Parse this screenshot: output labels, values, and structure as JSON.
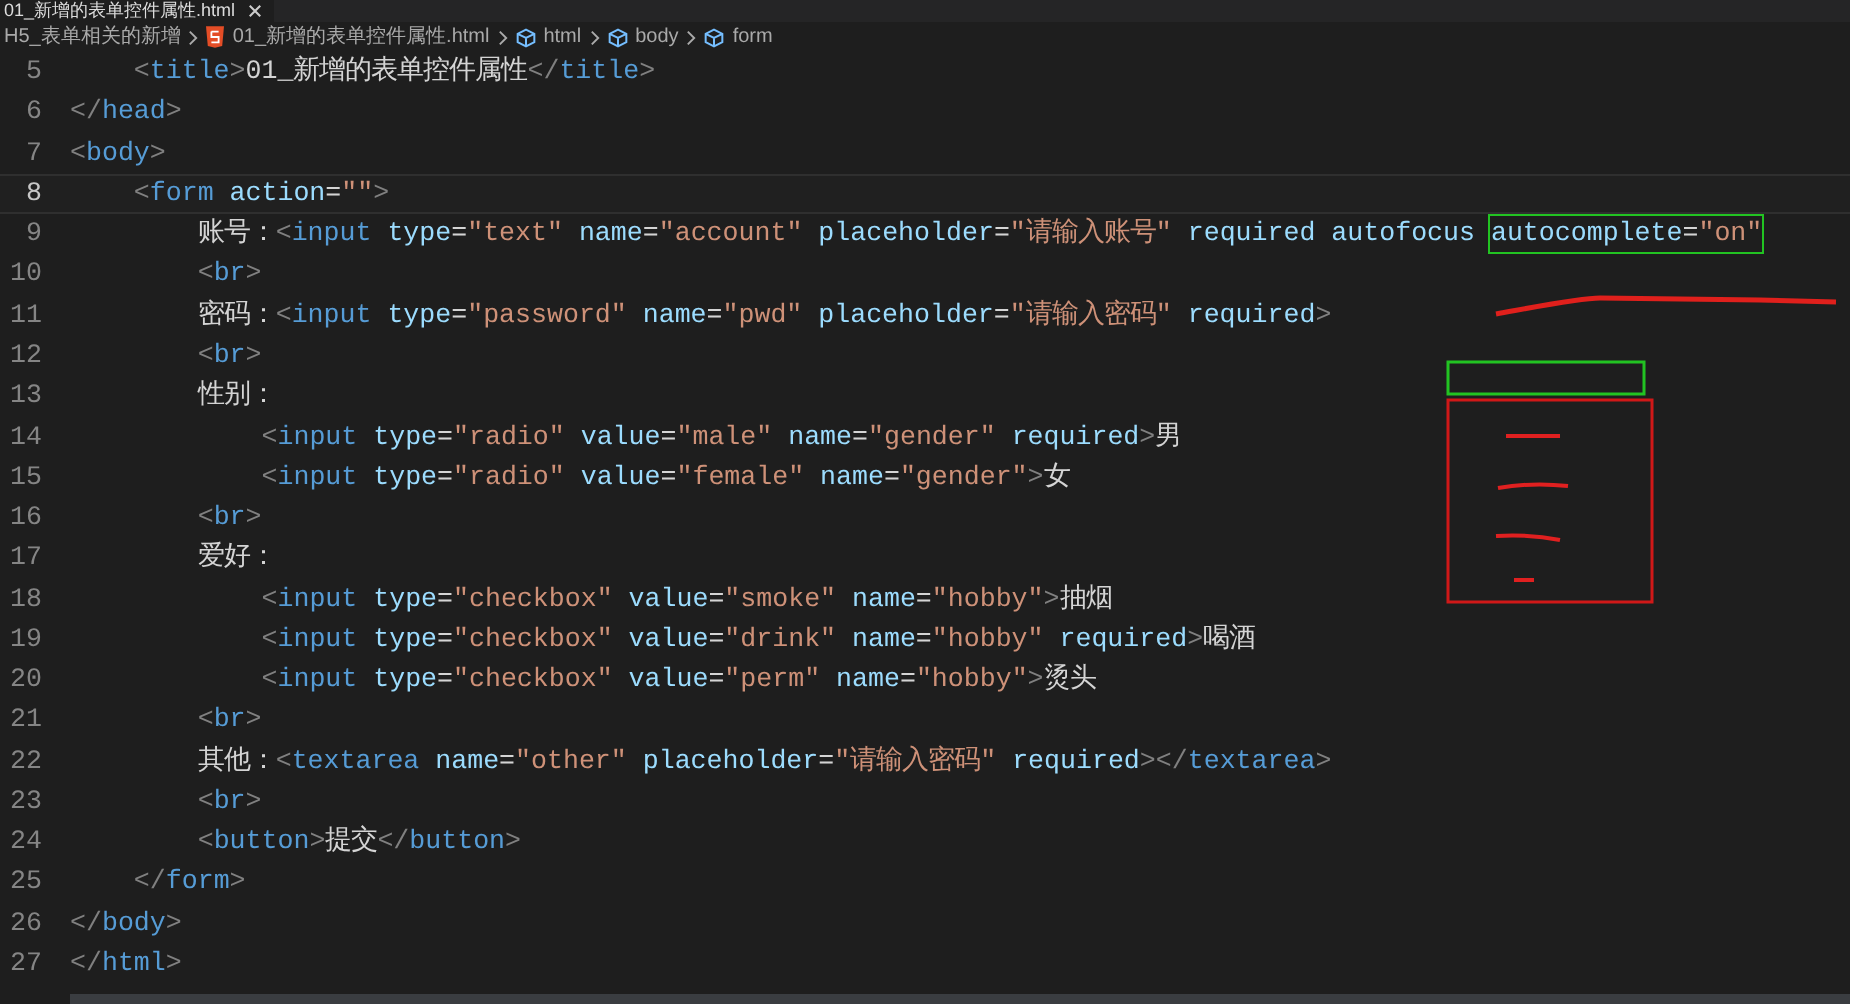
{
  "tab": {
    "title": "01_新增的表单控件属性.html"
  },
  "breadcrumb": [
    {
      "label": "H5_表单相关的新增",
      "kind": "folder"
    },
    {
      "label": "01_新增的表单控件属性.html",
      "kind": "file"
    },
    {
      "label": "html",
      "kind": "symbol"
    },
    {
      "label": "body",
      "kind": "symbol"
    },
    {
      "label": "form",
      "kind": "symbol"
    }
  ],
  "lines": [
    {
      "children": [
        {
          "num": "5",
          "current": false,
          "tokens": [
            {
              "kind": "p",
              "text": "<"
            },
            {
              "kind": "tag",
              "text": "title"
            },
            {
              "kind": "p",
              "text": ">"
            },
            {
              "kind": "text",
              "text": "01_新增的表单控件属性"
            },
            {
              "kind": "p",
              "text": "</"
            },
            {
              "kind": "tag",
              "text": "title"
            },
            {
              "kind": "p",
              "text": ">"
            }
          ]
        }
      ]
    },
    {
      "num": "6",
      "current": false,
      "tokens": [
        {
          "kind": "p",
          "text": "</"
        },
        {
          "kind": "tag",
          "text": "head"
        },
        {
          "kind": "p",
          "text": ">"
        }
      ]
    },
    {
      "num": "7",
      "current": false,
      "tokens": [
        {
          "kind": "p",
          "text": "<"
        },
        {
          "kind": "tag",
          "text": "body"
        },
        {
          "kind": "p",
          "text": ">"
        }
      ],
      "children": [
        {
          "num": "8",
          "current": true,
          "tokens": [
            {
              "kind": "p",
              "text": "<"
            },
            {
              "kind": "tag",
              "text": "form"
            },
            {
              "kind": "attr",
              "text": "action",
              "gap": true
            },
            {
              "kind": "text",
              "text": "="
            },
            {
              "kind": "str",
              "text": "\"\""
            },
            {
              "kind": "p",
              "text": ">"
            }
          ],
          "children": [
            {
              "num": "9",
              "current": false,
              "tokens": [
                {
                  "kind": "text",
                  "text": "账号："
                },
                {
                  "kind": "p",
                  "text": "<"
                },
                {
                  "kind": "tag",
                  "text": "input"
                },
                {
                  "kind": "attr",
                  "text": "type",
                  "gap": true
                },
                {
                  "kind": "text",
                  "text": "="
                },
                {
                  "kind": "str",
                  "text": "\"text\""
                },
                {
                  "kind": "attr",
                  "text": "name",
                  "gap": true
                },
                {
                  "kind": "text",
                  "text": "="
                },
                {
                  "kind": "str",
                  "text": "\"account\""
                },
                {
                  "kind": "attr",
                  "text": "placeholder",
                  "gap": true
                },
                {
                  "kind": "text",
                  "text": "="
                },
                {
                  "kind": "str",
                  "text": "\"请输入账号\""
                },
                {
                  "kind": "attr",
                  "text": "required",
                  "gap": true
                },
                {
                  "kind": "attr",
                  "text": "autofocus",
                  "gap": true
                }
              ],
              "boxed_tokens": [
                {
                  "kind": "attr",
                  "text": "autocomplete"
                },
                {
                  "kind": "text",
                  "text": "="
                },
                {
                  "kind": "str",
                  "text": "\"on\""
                }
              ]
            },
            {
              "num": "10",
              "current": false,
              "tokens": [
                {
                  "kind": "p",
                  "text": "<"
                },
                {
                  "kind": "tag",
                  "text": "br"
                },
                {
                  "kind": "p",
                  "text": ">"
                }
              ]
            },
            {
              "num": "11",
              "current": false,
              "tokens": [
                {
                  "kind": "text",
                  "text": "密码："
                },
                {
                  "kind": "p",
                  "text": "<"
                },
                {
                  "kind": "tag",
                  "text": "input"
                },
                {
                  "kind": "attr",
                  "text": "type",
                  "gap": true
                },
                {
                  "kind": "text",
                  "text": "="
                },
                {
                  "kind": "str",
                  "text": "\"password\""
                },
                {
                  "kind": "attr",
                  "text": "name",
                  "gap": true
                },
                {
                  "kind": "text",
                  "text": "="
                },
                {
                  "kind": "str",
                  "text": "\"pwd\""
                },
                {
                  "kind": "attr",
                  "text": "placeholder",
                  "gap": true
                },
                {
                  "kind": "text",
                  "text": "="
                },
                {
                  "kind": "str",
                  "text": "\"请输入密码\""
                },
                {
                  "kind": "attr",
                  "text": "required",
                  "gap": true
                },
                {
                  "kind": "p",
                  "text": ">"
                }
              ]
            },
            {
              "num": "12",
              "current": false,
              "tokens": [
                {
                  "kind": "p",
                  "text": "<"
                },
                {
                  "kind": "tag",
                  "text": "br"
                },
                {
                  "kind": "p",
                  "text": ">"
                }
              ]
            },
            {
              "num": "13",
              "current": false,
              "tokens": [
                {
                  "kind": "text",
                  "text": "性别："
                }
              ],
              "children": [
                {
                  "num": "14",
                  "current": false,
                  "tokens": [
                    {
                      "kind": "p",
                      "text": "<"
                    },
                    {
                      "kind": "tag",
                      "text": "input"
                    },
                    {
                      "kind": "attr",
                      "text": "type",
                      "gap": true
                    },
                    {
                      "kind": "text",
                      "text": "="
                    },
                    {
                      "kind": "str",
                      "text": "\"radio\""
                    },
                    {
                      "kind": "attr",
                      "text": "value",
                      "gap": true
                    },
                    {
                      "kind": "text",
                      "text": "="
                    },
                    {
                      "kind": "str",
                      "text": "\"male\""
                    },
                    {
                      "kind": "attr",
                      "text": "name",
                      "gap": true
                    },
                    {
                      "kind": "text",
                      "text": "="
                    },
                    {
                      "kind": "str",
                      "text": "\"gender\""
                    },
                    {
                      "kind": "attr",
                      "text": "required",
                      "gap": true
                    },
                    {
                      "kind": "p",
                      "text": ">"
                    },
                    {
                      "kind": "text",
                      "text": "男"
                    }
                  ]
                },
                {
                  "num": "15",
                  "current": false,
                  "tokens": [
                    {
                      "kind": "p",
                      "text": "<"
                    },
                    {
                      "kind": "tag",
                      "text": "input"
                    },
                    {
                      "kind": "attr",
                      "text": "type",
                      "gap": true
                    },
                    {
                      "kind": "text",
                      "text": "="
                    },
                    {
                      "kind": "str",
                      "text": "\"radio\""
                    },
                    {
                      "kind": "attr",
                      "text": "value",
                      "gap": true
                    },
                    {
                      "kind": "text",
                      "text": "="
                    },
                    {
                      "kind": "str",
                      "text": "\"female\""
                    },
                    {
                      "kind": "attr",
                      "text": "name",
                      "gap": true
                    },
                    {
                      "kind": "text",
                      "text": "="
                    },
                    {
                      "kind": "str",
                      "text": "\"gender\""
                    },
                    {
                      "kind": "p",
                      "text": ">"
                    },
                    {
                      "kind": "text",
                      "text": "女"
                    }
                  ]
                }
              ]
            },
            {
              "num": "16",
              "current": false,
              "tokens": [
                {
                  "kind": "p",
                  "text": "<"
                },
                {
                  "kind": "tag",
                  "text": "br"
                },
                {
                  "kind": "p",
                  "text": ">"
                }
              ]
            },
            {
              "num": "17",
              "current": false,
              "tokens": [
                {
                  "kind": "text",
                  "text": "爱好："
                }
              ],
              "children": [
                {
                  "num": "18",
                  "current": false,
                  "tokens": [
                    {
                      "kind": "p",
                      "text": "<"
                    },
                    {
                      "kind": "tag",
                      "text": "input"
                    },
                    {
                      "kind": "attr",
                      "text": "type",
                      "gap": true
                    },
                    {
                      "kind": "text",
                      "text": "="
                    },
                    {
                      "kind": "str",
                      "text": "\"checkbox\""
                    },
                    {
                      "kind": "attr",
                      "text": "value",
                      "gap": true
                    },
                    {
                      "kind": "text",
                      "text": "="
                    },
                    {
                      "kind": "str",
                      "text": "\"smoke\""
                    },
                    {
                      "kind": "attr",
                      "text": "name",
                      "gap": true
                    },
                    {
                      "kind": "text",
                      "text": "="
                    },
                    {
                      "kind": "str",
                      "text": "\"hobby\""
                    },
                    {
                      "kind": "p",
                      "text": ">"
                    },
                    {
                      "kind": "text",
                      "text": "抽烟"
                    }
                  ]
                },
                {
                  "num": "19",
                  "current": false,
                  "tokens": [
                    {
                      "kind": "p",
                      "text": "<"
                    },
                    {
                      "kind": "tag",
                      "text": "input"
                    },
                    {
                      "kind": "attr",
                      "text": "type",
                      "gap": true
                    },
                    {
                      "kind": "text",
                      "text": "="
                    },
                    {
                      "kind": "str",
                      "text": "\"checkbox\""
                    },
                    {
                      "kind": "attr",
                      "text": "value",
                      "gap": true
                    },
                    {
                      "kind": "text",
                      "text": "="
                    },
                    {
                      "kind": "str",
                      "text": "\"drink\""
                    },
                    {
                      "kind": "attr",
                      "text": "name",
                      "gap": true
                    },
                    {
                      "kind": "text",
                      "text": "="
                    },
                    {
                      "kind": "str",
                      "text": "\"hobby\""
                    },
                    {
                      "kind": "attr",
                      "text": "required",
                      "gap": true
                    },
                    {
                      "kind": "p",
                      "text": ">"
                    },
                    {
                      "kind": "text",
                      "text": "喝酒"
                    }
                  ]
                },
                {
                  "num": "20",
                  "current": false,
                  "tokens": [
                    {
                      "kind": "p",
                      "text": "<"
                    },
                    {
                      "kind": "tag",
                      "text": "input"
                    },
                    {
                      "kind": "attr",
                      "text": "type",
                      "gap": true
                    },
                    {
                      "kind": "text",
                      "text": "="
                    },
                    {
                      "kind": "str",
                      "text": "\"checkbox\""
                    },
                    {
                      "kind": "attr",
                      "text": "value",
                      "gap": true
                    },
                    {
                      "kind": "text",
                      "text": "="
                    },
                    {
                      "kind": "str",
                      "text": "\"perm\""
                    },
                    {
                      "kind": "attr",
                      "text": "name",
                      "gap": true
                    },
                    {
                      "kind": "text",
                      "text": "="
                    },
                    {
                      "kind": "str",
                      "text": "\"hobby\""
                    },
                    {
                      "kind": "p",
                      "text": ">"
                    },
                    {
                      "kind": "text",
                      "text": "烫头"
                    }
                  ]
                }
              ]
            },
            {
              "num": "21",
              "current": false,
              "tokens": [
                {
                  "kind": "p",
                  "text": "<"
                },
                {
                  "kind": "tag",
                  "text": "br"
                },
                {
                  "kind": "p",
                  "text": ">"
                }
              ]
            },
            {
              "num": "22",
              "current": false,
              "tokens": [
                {
                  "kind": "text",
                  "text": "其他："
                },
                {
                  "kind": "p",
                  "text": "<"
                },
                {
                  "kind": "tag",
                  "text": "textarea"
                },
                {
                  "kind": "attr",
                  "text": "name",
                  "gap": true
                },
                {
                  "kind": "text",
                  "text": "="
                },
                {
                  "kind": "str",
                  "text": "\"other\""
                },
                {
                  "kind": "attr",
                  "text": "placeholder",
                  "gap": true
                },
                {
                  "kind": "text",
                  "text": "="
                },
                {
                  "kind": "str",
                  "text": "\"请输入密码\""
                },
                {
                  "kind": "attr",
                  "text": "required",
                  "gap": true
                },
                {
                  "kind": "p",
                  "text": "></"
                },
                {
                  "kind": "tag",
                  "text": "textarea"
                },
                {
                  "kind": "p",
                  "text": ">"
                }
              ]
            },
            {
              "num": "23",
              "current": false,
              "tokens": [
                {
                  "kind": "p",
                  "text": "<"
                },
                {
                  "kind": "tag",
                  "text": "br"
                },
                {
                  "kind": "p",
                  "text": ">"
                }
              ]
            },
            {
              "num": "24",
              "current": false,
              "tokens": [
                {
                  "kind": "p",
                  "text": "<"
                },
                {
                  "kind": "tag",
                  "text": "button"
                },
                {
                  "kind": "p",
                  "text": ">"
                },
                {
                  "kind": "text",
                  "text": "提交"
                },
                {
                  "kind": "p",
                  "text": "</"
                },
                {
                  "kind": "tag",
                  "text": "button"
                },
                {
                  "kind": "p",
                  "text": ">"
                }
              ]
            }
          ]
        },
        {
          "num": "25",
          "current": false,
          "tokens": [
            {
              "kind": "p",
              "text": "</"
            },
            {
              "kind": "tag",
              "text": "form"
            },
            {
              "kind": "p",
              "text": ">"
            }
          ]
        }
      ]
    },
    {
      "num": "26",
      "current": false,
      "tokens": [
        {
          "kind": "p",
          "text": "</"
        },
        {
          "kind": "tag",
          "text": "body"
        },
        {
          "kind": "p",
          "text": ">"
        }
      ]
    },
    {
      "num": "27",
      "current": false,
      "tokens": [
        {
          "kind": "p",
          "text": "</"
        },
        {
          "kind": "tag",
          "text": "html"
        },
        {
          "kind": "p",
          "text": ">"
        }
      ]
    }
  ]
}
